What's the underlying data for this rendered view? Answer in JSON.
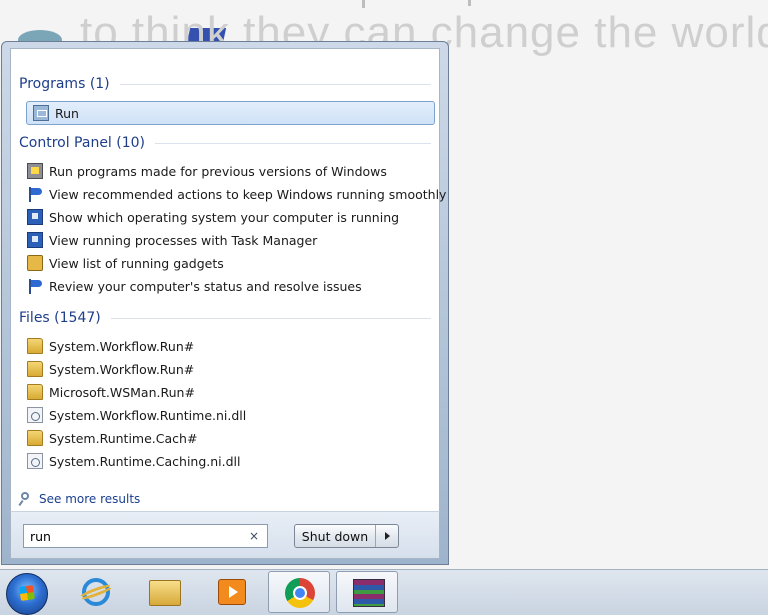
{
  "wallpaper": {
    "text": "to think they can change the world"
  },
  "start_menu": {
    "groups": [
      {
        "header": "Programs (1)",
        "items": [
          {
            "label": "Run",
            "icon": "run-icon"
          }
        ]
      },
      {
        "header": "Control Panel (10)",
        "items": [
          {
            "label": "Run programs made for previous versions of Windows",
            "icon": "compatibility-icon"
          },
          {
            "label": "View recommended actions to keep Windows running smoothly",
            "icon": "action-center-flag-icon"
          },
          {
            "label": "Show which operating system your computer is running",
            "icon": "system-monitor-icon"
          },
          {
            "label": "View running processes with Task Manager",
            "icon": "system-monitor-icon"
          },
          {
            "label": "View list of running gadgets",
            "icon": "gadgets-icon"
          },
          {
            "label": "Review your computer's status and resolve issues",
            "icon": "action-center-flag-icon"
          }
        ]
      },
      {
        "header": "Files (1547)",
        "items": [
          {
            "label": "System.Workflow.Run#",
            "icon": "folder-icon"
          },
          {
            "label": "System.Workflow.Run#",
            "icon": "folder-icon"
          },
          {
            "label": "Microsoft.WSMan.Run#",
            "icon": "folder-icon"
          },
          {
            "label": "System.Workflow.Runtime.ni.dll",
            "icon": "dll-file-icon"
          },
          {
            "label": "System.Runtime.Cach#",
            "icon": "folder-icon"
          },
          {
            "label": "System.Runtime.Caching.ni.dll",
            "icon": "dll-file-icon"
          }
        ]
      }
    ],
    "see_more": "See more results",
    "search": {
      "value": "run",
      "clear": "×"
    },
    "shutdown_label": "Shut down"
  },
  "taskbar": {
    "buttons": [
      "start-orb",
      "internet-explorer-icon",
      "windows-explorer-icon",
      "media-player-icon",
      "chrome-icon",
      "winrar-icon"
    ],
    "active": [
      "chrome-icon",
      "winrar-icon"
    ]
  }
}
